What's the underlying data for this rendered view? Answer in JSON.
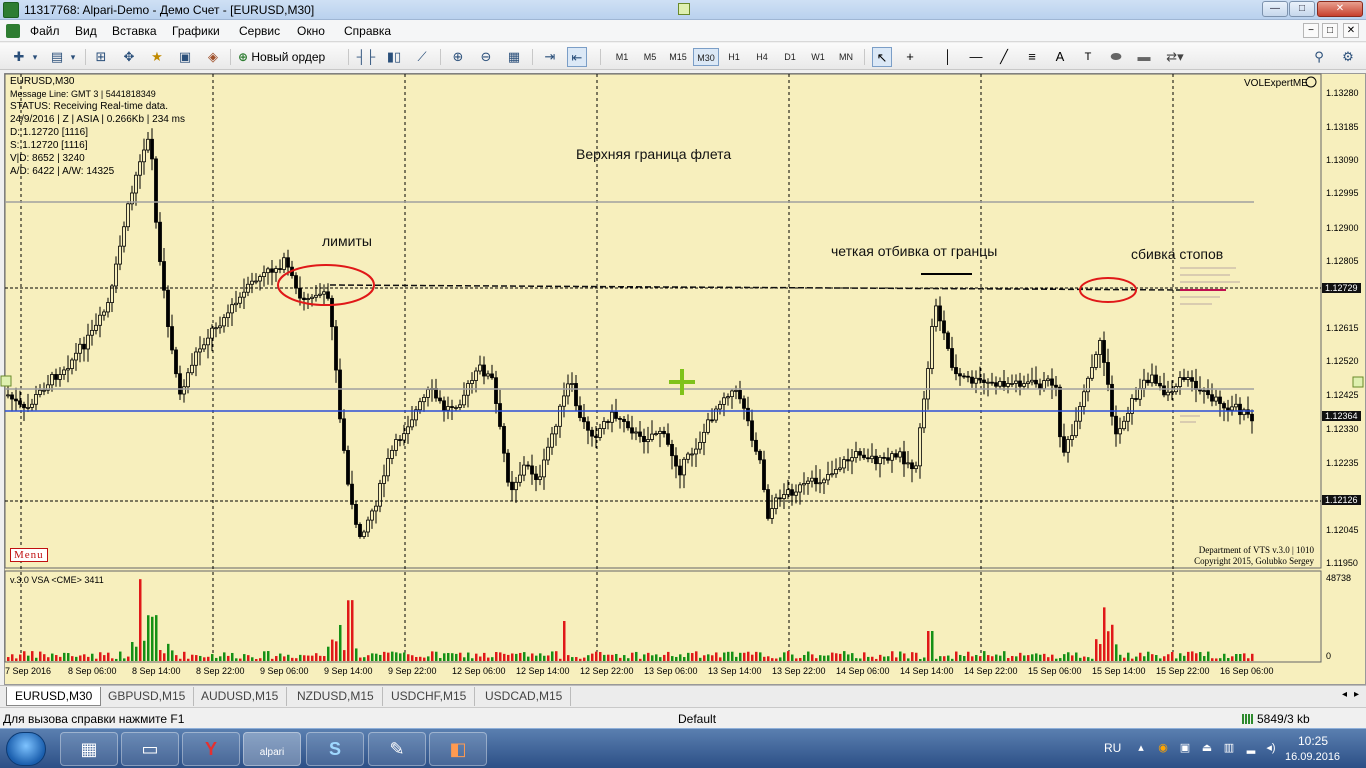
{
  "window": {
    "title": "11317768: Alpari-Demo - Демо Счет - [EURUSD,M30]",
    "min_label": "—",
    "max_label": "□",
    "close_label": "✕"
  },
  "menu": {
    "items": [
      "Файл",
      "Вид",
      "Вставка",
      "Графики",
      "Сервис",
      "Окно",
      "Справка"
    ],
    "mdi_min": "−",
    "mdi_restore": "□",
    "mdi_close": "✕"
  },
  "toolbar": {
    "new_order": "Новый ордер",
    "timeframes": [
      "M1",
      "M5",
      "M15",
      "M30",
      "H1",
      "H4",
      "D1",
      "W1",
      "MN"
    ],
    "active_timeframe": "M30",
    "text_tool": "A",
    "label_tool": "T",
    "search_icon": "search-icon",
    "settings_icon": "gear-icon"
  },
  "chart": {
    "symbol_header": "EURUSD,M30",
    "info_lines": [
      "Message Line: GMT 3 | 5441818349",
      "STATUS:  Receiving Real-time data.",
      "24/9/2016 | Z | ASIA | 0.266Kb | 234 ms",
      "D: 1.12720  [1116]",
      "S: 1.12720  [1116]",
      "V|D: 8652 | 3240",
      "A/D: 6422 | A/W: 14325"
    ],
    "menu_label": "Menu",
    "expert_name": "VOLExpertME",
    "department": "Department of VTS  v.3.0 | 1010",
    "copyright": "Copyright 2015, Golubko Sergey",
    "annotations": {
      "upper": "Верхняя граница флета",
      "limits": "лимиты",
      "bounce": "четкая отбивка от гранцы",
      "stops": "сбивка стопов"
    },
    "price_ticks": [
      "1.13280",
      "1.13185",
      "1.13090",
      "1.12995",
      "1.12900",
      "1.12805",
      "1.12615",
      "1.12520",
      "1.12425",
      "1.12330",
      "1.12235",
      "1.12045",
      "1.11950"
    ],
    "price_markers": [
      "1.12729",
      "1.12364",
      "1.12126"
    ],
    "time_ticks": [
      "7 Sep 2016",
      "8 Sep 06:00",
      "8 Sep 14:00",
      "8 Sep 22:00",
      "9 Sep 06:00",
      "9 Sep 14:00",
      "9 Sep 22:00",
      "12 Sep 06:00",
      "12 Sep 14:00",
      "12 Sep 22:00",
      "13 Sep 06:00",
      "13 Sep 14:00",
      "13 Sep 22:00",
      "14 Sep 06:00",
      "14 Sep 14:00",
      "14 Sep 22:00",
      "15 Sep 06:00",
      "15 Sep 14:00",
      "15 Sep 22:00",
      "16 Sep 06:00"
    ],
    "sub_label": "v.3.0 VSA <CME> 3411",
    "sub_max": "48738",
    "sub_min": "0",
    "colors": {
      "background": "#f7efbd",
      "candle": "#000000",
      "support_line": "#2b4fd6",
      "circle": "#e01818",
      "volume_up": "#159015",
      "volume_down": "#e01818"
    }
  },
  "tabs": [
    "EURUSD,M30",
    "GBPUSD,M15",
    "AUDUSD,M15",
    "NZDUSD,M15",
    "USDCHF,M15",
    "USDCAD,M15"
  ],
  "active_tab": "EURUSD,M30",
  "status": {
    "help": "Для вызова справки нажмите F1",
    "profile": "Default",
    "connection": "5849/3 kb"
  },
  "taskbar": {
    "alpari_label": "alpari",
    "language": "RU",
    "time": "10:25",
    "date": "16.09.2016"
  }
}
